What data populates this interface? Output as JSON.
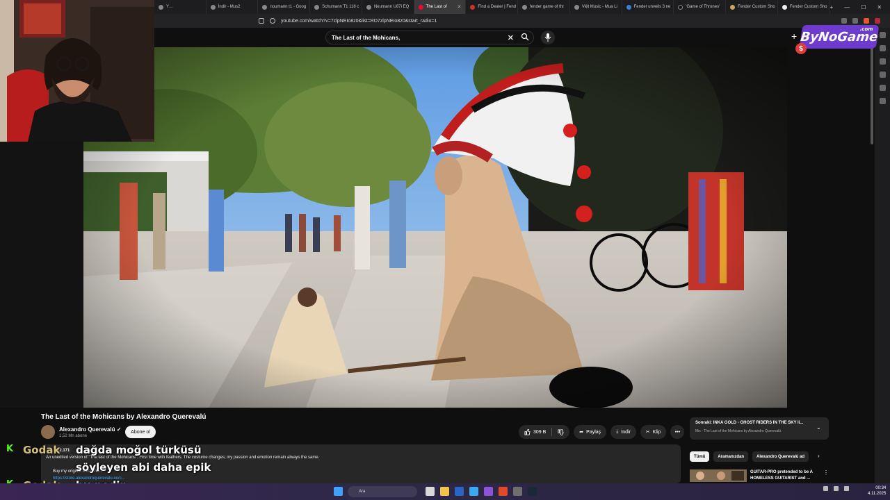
{
  "browser": {
    "tabs": [
      {
        "label": "Y…",
        "active": false
      },
      {
        "label": "İndir - Mus2",
        "active": false
      },
      {
        "label": "noumann t1 - Goog",
        "active": false
      },
      {
        "label": "Schumann T1 118 c",
        "active": false
      },
      {
        "label": "Neumann U87i EQ",
        "active": false
      },
      {
        "label": "The Last of",
        "active": true
      },
      {
        "label": "Find a Dealer | Fend",
        "active": false
      },
      {
        "label": "fender game of thr",
        "active": false
      },
      {
        "label": "Việt Music - Mua Li",
        "active": false
      },
      {
        "label": "Fender unveils 3 ne",
        "active": false
      },
      {
        "label": "'Game of Thrones'",
        "active": false
      },
      {
        "label": "Fender Custom Sho",
        "active": false
      },
      {
        "label": "Fender Custom Sho",
        "active": false
      }
    ],
    "url": "youtube.com/watch?v=7zlpNEIo8z0&list=RD7zlpNEIo8z0&start_radio=1"
  },
  "youtube": {
    "search_value": "The Last of the Mohicans,",
    "video_title": "The Last of the Mohicans by Alexandro Querevalú",
    "channel_name": "Alexandro Querevalú ✓",
    "channel_subs": "1,52 Mn abone",
    "subscribe_label": "Abone ol",
    "like_count": "309 B",
    "share_label": "Paylaş",
    "download_label": "İndir",
    "clip_label": "Klip",
    "views": "22.171",
    "description": "An unedited version of \"The last of the Mohicans\". First time with feathers. The costume changes; my passion and emotion remain always the same.",
    "buy_line": "Buy my original music he...",
    "link_line": "https://store.alexandroquerevalu.eu/c...",
    "up_next_title": "Sonraki: INKA GOLD - GHOST RIDERS IN THE SKY li...",
    "up_next_sub": "Mix - The Last of the Mohicans by Alexandro Querevalú",
    "chips": [
      "Tümü",
      "Aramanızdan",
      "Alexandro Querevalú ad"
    ],
    "rec_title": "GUITAR-PRO pretended to be A HOMELESS GUITARIST and ..."
  },
  "overlay": {
    "logo_text": "ByNoGame",
    "logo_sub": ".com",
    "dollar": "$",
    "chat": [
      {
        "user": "Godak",
        "lines": [
          "dağda moğol türküsü",
          "söyleyen abi daha epik"
        ]
      },
      {
        "user": "Godak",
        "lines": [
          "bu nedir"
        ]
      }
    ]
  },
  "taskbar": {
    "search_placeholder": "Ara",
    "time": "00:34",
    "date": "4.11.2025"
  },
  "colors": {
    "accent_green": "#53fc18",
    "logo_purple": "#6d3ccf"
  }
}
